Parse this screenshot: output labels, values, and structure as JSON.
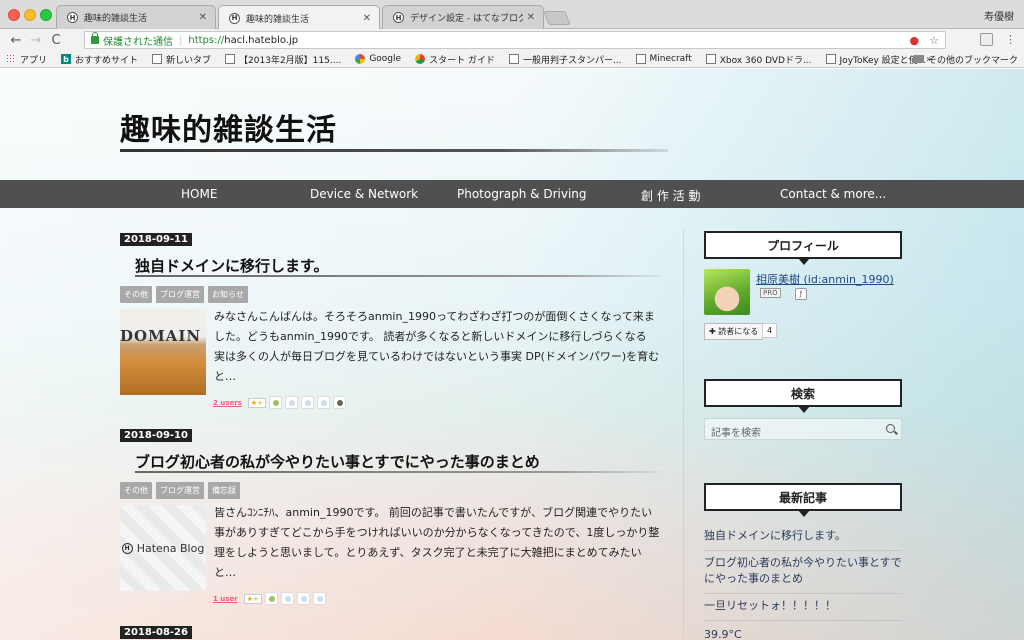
{
  "browser": {
    "tabs": [
      {
        "label": "趣味的雑談生活",
        "favicon": "H",
        "active": false
      },
      {
        "label": "趣味的雑談生活",
        "favicon": "H",
        "active": true
      },
      {
        "label": "デザイン設定 - はてなブログ",
        "favicon": "H",
        "active": false
      }
    ],
    "close_glyph": "✕",
    "profile_name": "寿優樹",
    "nav": {
      "back": "←",
      "forward": "→",
      "reload": "C"
    },
    "omnibox": {
      "secure_label": "保護された通信",
      "scheme": "https://",
      "host": "hacl.hateblo.jp"
    },
    "omni_icons": {
      "star": "☆"
    },
    "menu_glyph": "⋮",
    "bookmarks": [
      {
        "label": "アプリ",
        "icon": "grid"
      },
      {
        "label": "おすすめサイト",
        "icon": "bing",
        "glyph": "b"
      },
      {
        "label": "新しいタブ",
        "icon": "page"
      },
      {
        "label": "【2013年2月版】115....",
        "icon": "page"
      },
      {
        "label": "Google",
        "icon": "g"
      },
      {
        "label": "スタート ガイド",
        "icon": "chrome"
      },
      {
        "label": "一般用判子スタンパー...",
        "icon": "page"
      },
      {
        "label": "Minecraft",
        "icon": "page"
      },
      {
        "label": "Xbox 360 DVDドラ...",
        "icon": "page"
      },
      {
        "label": "JoyToKey 設定と使...",
        "icon": "page"
      }
    ],
    "bookmarks_more": "»",
    "bookmarks_other": "その他のブックマーク"
  },
  "blog": {
    "title": "趣味的雑談生活",
    "nav": [
      "HOME",
      "Device & Network",
      "Photograph & Driving",
      "創 作 活 動",
      "Contact & more..."
    ]
  },
  "entries": [
    {
      "date": "2018-09-11",
      "title": "独自ドメインに移行します。",
      "categories": [
        "その他",
        "ブログ運営",
        "お知らせ"
      ],
      "thumb_word": "DOMAIN",
      "excerpt": "みなさんこんばんは。そろそろanmin_1990ってわざわざ打つのが面倒くさくなって来ました。どうもanmin_1990です。 読者が多くなると新しいドメインに移行しづらくなる 実は多くの人が毎日ブログを見ているわけではないという事実 DP(ドメインパワー)を育むと…",
      "users": "2 users",
      "star_button": "★+"
    },
    {
      "date": "2018-09-10",
      "title": "ブログ初心者の私が今やりたい事とすでにやった事のまとめ",
      "categories": [
        "その他",
        "ブログ運営",
        "備忘録"
      ],
      "thumb_word": "Hatena Blog",
      "excerpt": "皆さんｺﾝﾆﾁﾊ、anmin_1990です。 前回の記事で書いたんですが、ブログ関連でやりたい事がありすぎてどこから手をつければいいのか分からなくなってきたので、1度しっかり整理をしようと思いまして。とりあえず、タスク完了と未完了に大雑把にまとめてみたいと…",
      "users": "1 user",
      "star_button": "★+"
    },
    {
      "date": "2018-08-26"
    }
  ],
  "sidebar": {
    "profile_heading": "プロフィール",
    "profile_name": "相原美樹 (id:anmin_1990)",
    "pro_badge": "PRO",
    "follow_label": "✚ 読者になる",
    "follow_count": "4",
    "search_heading": "検索",
    "search_placeholder": "記事を検索",
    "recent_heading": "最新記事",
    "recent_items": [
      "独自ドメインに移行します。",
      "ブログ初心者の私が今やりたい事とすでにやった事のまとめ",
      "一旦リセットォ！！！！！"
    ],
    "temperature": "39.9°C"
  }
}
